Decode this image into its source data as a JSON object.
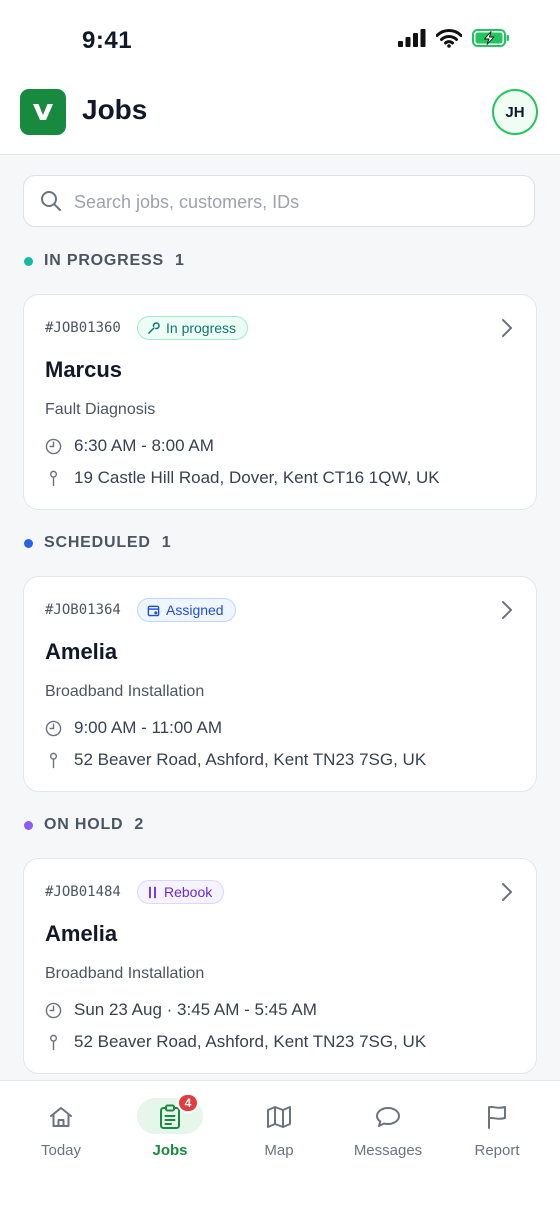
{
  "status_bar": {
    "time": "9:41"
  },
  "header": {
    "title": "Jobs",
    "avatar_initials": "JH",
    "logo_icon": "v-logo-icon"
  },
  "search": {
    "placeholder": "Search jobs, customers, IDs"
  },
  "colors": {
    "brand": "#188a3f",
    "in_progress_dot": "#14b8a6",
    "scheduled_dot": "#2563eb",
    "on_hold_dot": "#8b5cf6",
    "badge_alert": "#e23c3c"
  },
  "sections": [
    {
      "title": "IN PROGRESS",
      "count": "1",
      "jobs": [
        {
          "id": "#JOB01360",
          "status": "In progress",
          "status_icon": "wrench-icon",
          "customer": "Marcus",
          "service": "Fault Diagnosis",
          "time": "6:30 AM - 8:00 AM",
          "address": "19 Castle Hill Road, Dover, Kent CT16 1QW, UK"
        }
      ]
    },
    {
      "title": "SCHEDULED",
      "count": "1",
      "jobs": [
        {
          "id": "#JOB01364",
          "status": "Assigned",
          "status_icon": "calendar-icon",
          "customer": "Amelia",
          "service": "Broadband Installation",
          "time": "9:00 AM - 11:00 AM",
          "address": "52 Beaver Road, Ashford, Kent TN23 7SG, UK"
        }
      ]
    },
    {
      "title": "ON HOLD",
      "count": "2",
      "jobs": [
        {
          "id": "#JOB01484",
          "status": "Rebook",
          "status_icon": "pause-icon",
          "customer": "Amelia",
          "service": "Broadband Installation",
          "time": "Sun 23 Aug · 3:45 AM - 5:45 AM",
          "address": "52 Beaver Road, Ashford, Kent TN23 7SG, UK"
        }
      ]
    }
  ],
  "tabbar": {
    "active": "Jobs",
    "items": [
      {
        "label": "Today",
        "icon": "home-icon"
      },
      {
        "label": "Jobs",
        "icon": "clipboard-icon",
        "badge": "4"
      },
      {
        "label": "Map",
        "icon": "map-icon"
      },
      {
        "label": "Messages",
        "icon": "chat-bubble-icon"
      },
      {
        "label": "Report",
        "icon": "flag-icon"
      }
    ]
  }
}
